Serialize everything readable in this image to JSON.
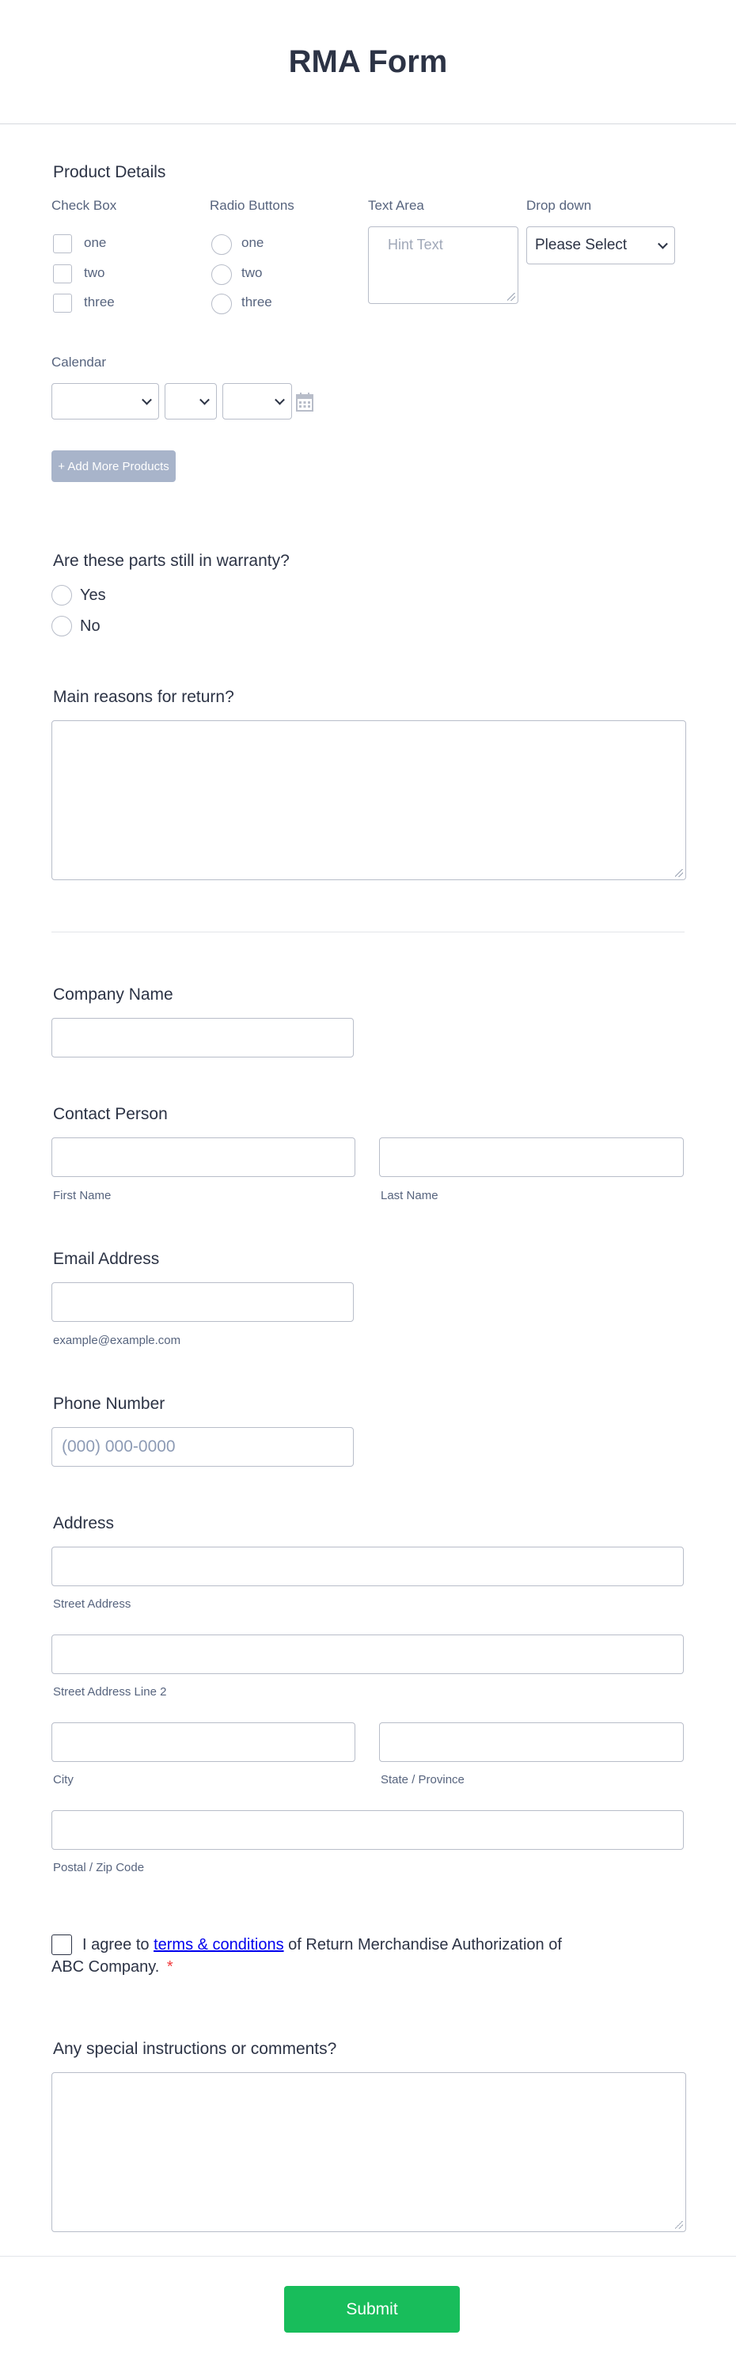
{
  "form": {
    "title": "RMA Form"
  },
  "product_details": {
    "heading": "Product Details",
    "checkbox_label": "Check Box",
    "checkbox_options": [
      "one",
      "two",
      "three"
    ],
    "radio_label": "Radio Buttons",
    "radio_options": [
      "one",
      "two",
      "three"
    ],
    "textarea_label": "Text Area",
    "textarea_placeholder": "Hint Text",
    "dropdown_label": "Drop down",
    "dropdown_value": "Please Select",
    "calendar_label": "Calendar",
    "add_more_label": "+ Add More Products"
  },
  "warranty": {
    "question": "Are these parts still in warranty?",
    "options": [
      "Yes",
      "No"
    ]
  },
  "reasons": {
    "label": "Main reasons for return?"
  },
  "company": {
    "label": "Company Name"
  },
  "contact": {
    "label": "Contact Person",
    "first_sub": "First Name",
    "last_sub": "Last Name"
  },
  "email": {
    "label": "Email Address",
    "sub": "example@example.com"
  },
  "phone": {
    "label": "Phone Number",
    "placeholder": "(000) 000-0000"
  },
  "address": {
    "label": "Address",
    "street_sub": "Street Address",
    "street2_sub": "Street Address Line 2",
    "city_sub": "City",
    "state_sub": "State / Province",
    "zip_sub": "Postal / Zip Code"
  },
  "terms": {
    "prefix": "I agree to ",
    "link_text": "terms & conditions",
    "suffix_line1": " of Return Merchandise Authorization of",
    "line2": "ABC Company.",
    "required_mark": "*"
  },
  "comments": {
    "label": "Any special instructions or comments?"
  },
  "submit": {
    "label": "Submit"
  },
  "colors": {
    "submit": "#18bd5b",
    "add_more": "#a8b4ca",
    "required": "#f23a3c",
    "link": "#0000ee"
  }
}
